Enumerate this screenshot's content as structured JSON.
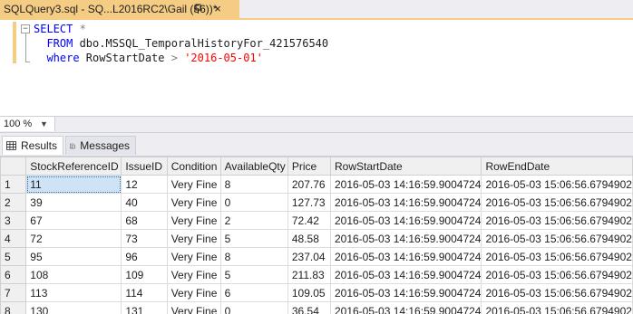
{
  "document_tab": {
    "title": "SQLQuery3.sql - SQ...L2016RC2\\Gail (56))*",
    "close_glyph": "×"
  },
  "editor": {
    "line1_keyword": "SELECT",
    "line1_rest": " *",
    "line2_keyword": "FROM",
    "line2_object": " dbo.MSSQL_TemporalHistoryFor_421576540",
    "line3_keyword": "where",
    "line3_column": " RowStartDate ",
    "line3_operator": ">",
    "line3_value": " '2016-05-01'"
  },
  "zoom": {
    "value": "100 %"
  },
  "results_tabs": [
    {
      "label": "Results",
      "icon": "grid-icon",
      "active": true
    },
    {
      "label": "Messages",
      "icon": "messages-icon",
      "active": false
    }
  ],
  "grid": {
    "columns": [
      "",
      "StockReferenceID",
      "IssueID",
      "Condition",
      "AvailableQty",
      "Price",
      "RowStartDate",
      "RowEndDate"
    ],
    "rows": [
      [
        "1",
        "11",
        "12",
        "Very Fine",
        "8",
        "207.76",
        "2016-05-03 14:16:59.9004724",
        "2016-05-03 15:06:56.6794902"
      ],
      [
        "2",
        "39",
        "40",
        "Very Fine",
        "0",
        "127.73",
        "2016-05-03 14:16:59.9004724",
        "2016-05-03 15:06:56.6794902"
      ],
      [
        "3",
        "67",
        "68",
        "Very Fine",
        "2",
        "72.42",
        "2016-05-03 14:16:59.9004724",
        "2016-05-03 15:06:56.6794902"
      ],
      [
        "4",
        "72",
        "73",
        "Very Fine",
        "5",
        "48.58",
        "2016-05-03 14:16:59.9004724",
        "2016-05-03 15:06:56.6794902"
      ],
      [
        "5",
        "95",
        "96",
        "Very Fine",
        "8",
        "237.04",
        "2016-05-03 14:16:59.9004724",
        "2016-05-03 15:06:56.6794902"
      ],
      [
        "6",
        "108",
        "109",
        "Very Fine",
        "5",
        "211.83",
        "2016-05-03 14:16:59.9004724",
        "2016-05-03 15:06:56.6794902"
      ],
      [
        "7",
        "113",
        "114",
        "Very Fine",
        "6",
        "109.05",
        "2016-05-03 14:16:59.9004724",
        "2016-05-03 15:06:56.6794902"
      ],
      [
        "8",
        "130",
        "131",
        "Very Fine",
        "0",
        "36.54",
        "2016-05-03 14:16:59.9004724",
        "2016-05-03 15:06:56.6794902"
      ]
    ],
    "selected_cell": {
      "row": 0,
      "column": 1
    }
  },
  "colors": {
    "active_tab": "#f5cc84",
    "keyword": "#0000ff",
    "string": "#ff0000",
    "operator": "#808080",
    "selection": "#cfe3f7"
  }
}
